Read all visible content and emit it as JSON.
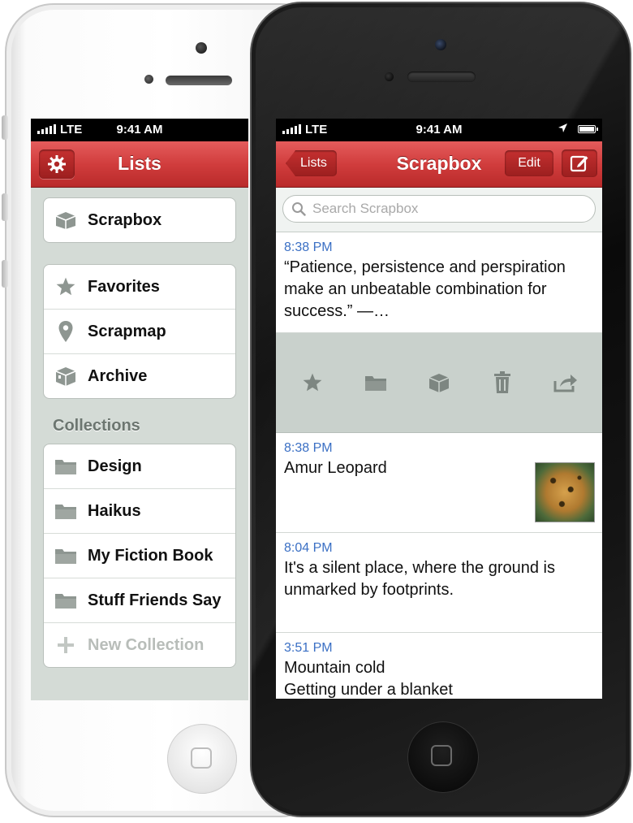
{
  "status_left": {
    "carrier": "LTE",
    "time": "9:41 AM"
  },
  "status_right": {
    "carrier": "LTE",
    "time": "9:41 AM"
  },
  "lists_screen": {
    "title": "Lists",
    "top_items": [
      {
        "label": "Scrapbox",
        "icon": "box-icon"
      }
    ],
    "main_items": [
      {
        "label": "Favorites",
        "icon": "star-icon"
      },
      {
        "label": "Scrapmap",
        "icon": "map-pin-icon"
      },
      {
        "label": "Archive",
        "icon": "archive-box-icon"
      }
    ],
    "collections_header": "Collections",
    "collections": [
      {
        "label": "Design",
        "icon": "folder-icon"
      },
      {
        "label": "Haikus",
        "icon": "folder-icon"
      },
      {
        "label": "My Fiction Book",
        "icon": "folder-icon"
      },
      {
        "label": "Stuff Friends Say",
        "icon": "folder-icon"
      }
    ],
    "new_collection_label": "New Collection"
  },
  "scrapbox_screen": {
    "title": "Scrapbox",
    "back_label": "Lists",
    "edit_label": "Edit",
    "search_placeholder": "Search Scrapbox",
    "notes": [
      {
        "time": "8:38 PM",
        "text": "“Patience, persistence and perspiration make an unbeatable combination for success.” —…"
      },
      {
        "time": "8:38 PM",
        "text": "Amur Leopard",
        "has_image": true
      },
      {
        "time": "8:04 PM",
        "text": "It's a silent place, where the ground is unmarked by footprints."
      },
      {
        "time": "3:51 PM",
        "text": "Mountain cold\nGetting under a blanket"
      }
    ],
    "actions": [
      "star-icon",
      "folder-icon",
      "archive-box-icon",
      "trash-icon",
      "share-icon"
    ]
  },
  "colors": {
    "accent": "#d13d3d",
    "time_blue": "#3a6fc4",
    "background": "#d4dbd6"
  }
}
